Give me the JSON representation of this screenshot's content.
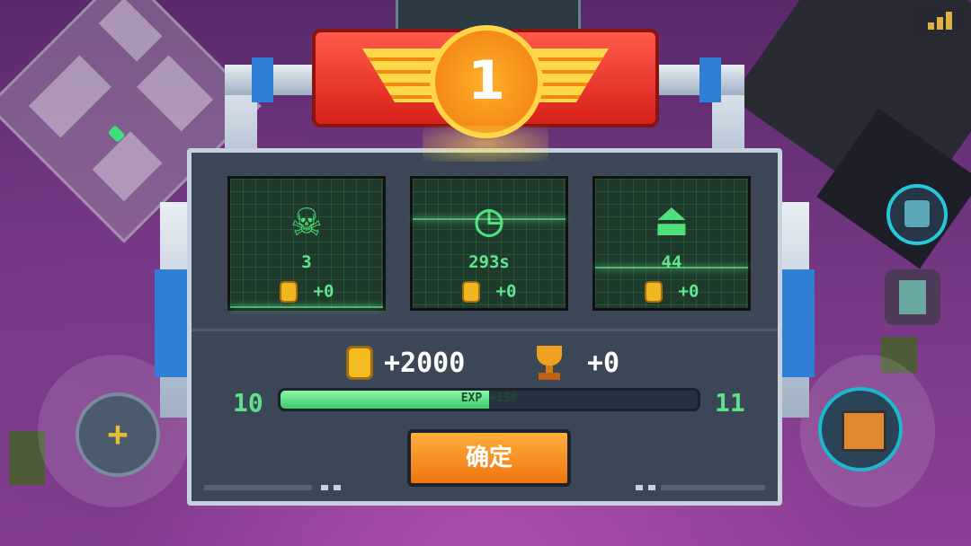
{
  "rank": "1",
  "stats": [
    {
      "icon": "skull-icon",
      "glyph": "☠",
      "value": "3",
      "reward": "+0"
    },
    {
      "icon": "clock-icon",
      "glyph": "◷",
      "value": "293s",
      "reward": "+0"
    },
    {
      "icon": "weight-icon",
      "glyph": "⏏",
      "value": "44",
      "reward": "+0"
    }
  ],
  "totals": {
    "coins": "+2000",
    "trophies": "+0"
  },
  "level": {
    "current": "10",
    "next": "11",
    "exp_label": "EXP +150",
    "progress": 0.5
  },
  "confirm_label": "确定",
  "colors": {
    "accent_green": "#5fe08a",
    "button_orange": "#ef7610",
    "banner_red": "#d7201a"
  }
}
